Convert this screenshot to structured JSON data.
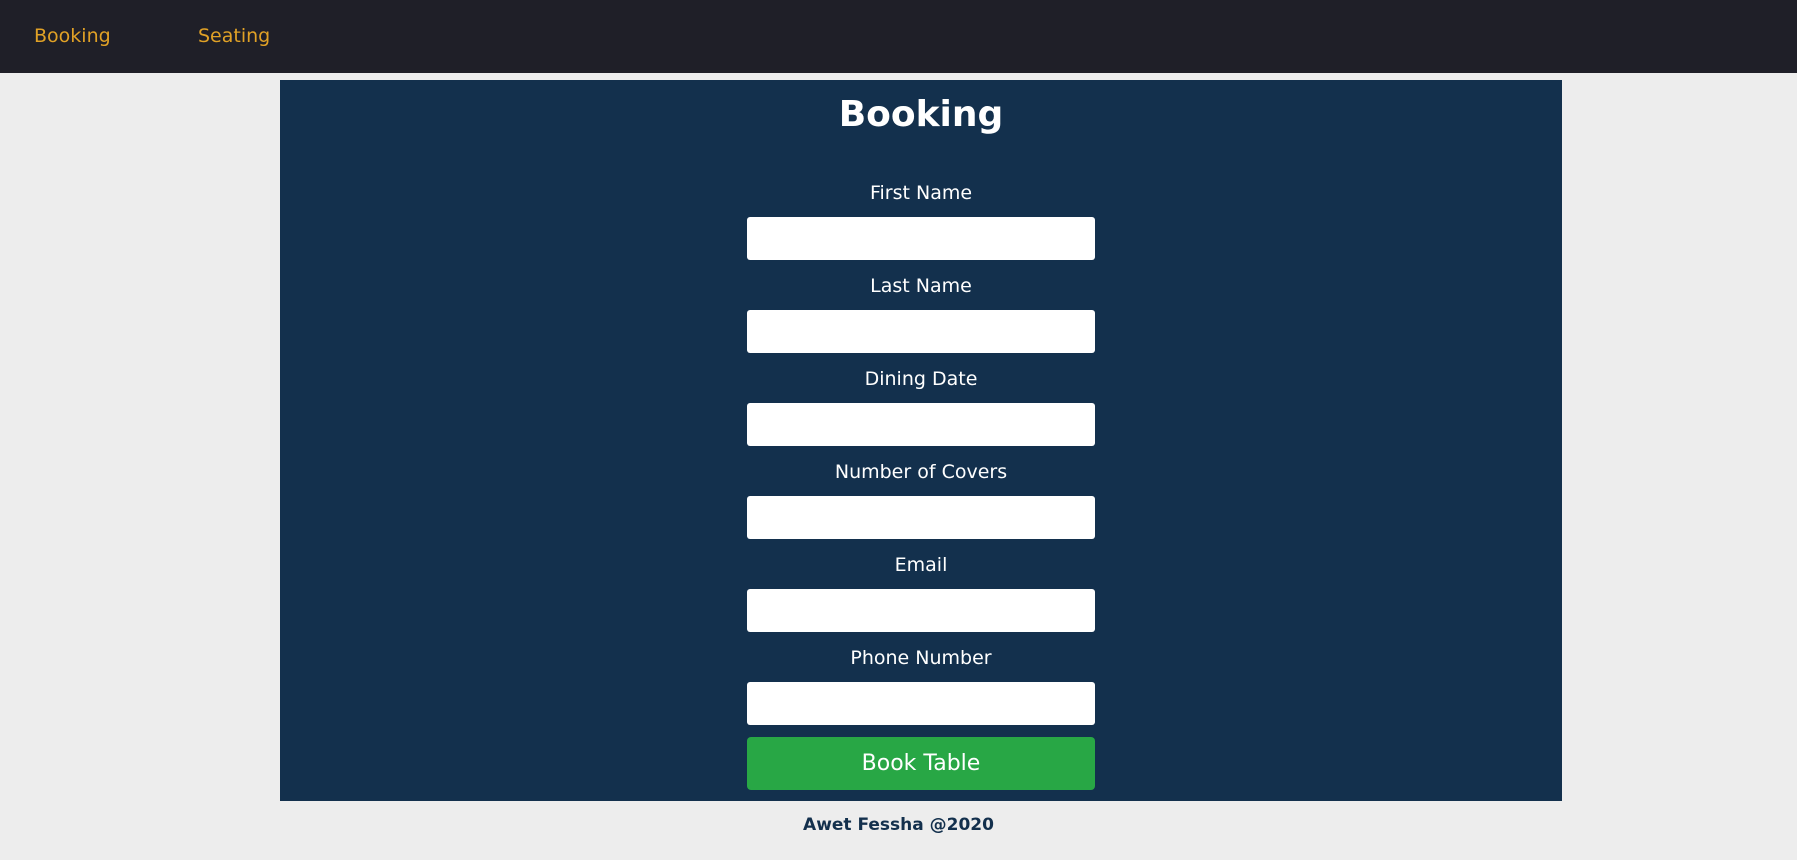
{
  "nav": {
    "links": [
      {
        "label": "Booking"
      },
      {
        "label": "Seating"
      }
    ]
  },
  "form": {
    "title": "Booking",
    "fields": [
      {
        "label": "First Name",
        "value": "",
        "placeholder": ""
      },
      {
        "label": "Last Name",
        "value": "",
        "placeholder": ""
      },
      {
        "label": "Dining Date",
        "value": "",
        "placeholder": ""
      },
      {
        "label": "Number of Covers",
        "value": "",
        "placeholder": ""
      },
      {
        "label": "Email",
        "value": "",
        "placeholder": ""
      },
      {
        "label": "Phone Number",
        "value": "",
        "placeholder": ""
      }
    ],
    "submit_label": "Book Table"
  },
  "footer": {
    "text": "Awet Fessha @2020"
  },
  "colors": {
    "navbar_bg": "#1f1f28",
    "nav_link": "#e0a126",
    "panel_bg": "#13304d",
    "button_bg": "#28a745",
    "page_bg": "#ededed"
  }
}
